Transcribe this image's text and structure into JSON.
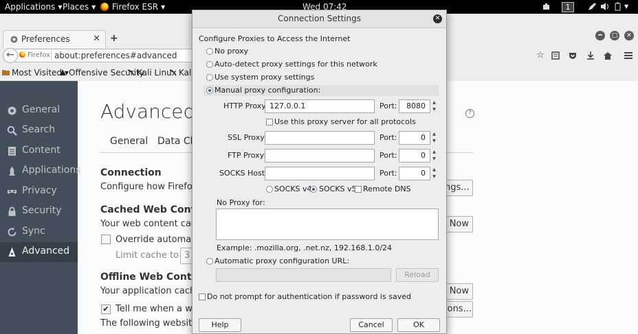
{
  "topbar": {
    "applications": "Applications",
    "places": "Places",
    "app_name": "Firefox ESR",
    "clock": "Wed 07:42",
    "workspace": "1"
  },
  "browser": {
    "tab_title": "Preferences",
    "identity_label": "Firefox",
    "url": "about:preferences#advanced",
    "bookmarks": [
      "Most Visited ▾",
      "Offensive Security",
      "Kali Linux",
      "Kali"
    ]
  },
  "prefs": {
    "sidebar": [
      {
        "label": "General",
        "icon": "gear-icon"
      },
      {
        "label": "Search",
        "icon": "search-icon"
      },
      {
        "label": "Content",
        "icon": "document-icon"
      },
      {
        "label": "Applications",
        "icon": "rocket-icon"
      },
      {
        "label": "Privacy",
        "icon": "mask-icon"
      },
      {
        "label": "Security",
        "icon": "lock-icon"
      },
      {
        "label": "Sync",
        "icon": "sync-icon"
      },
      {
        "label": "Advanced",
        "icon": "wizard-icon"
      }
    ],
    "heading": "Advanced",
    "subtabs": [
      "General",
      "Data Cho"
    ],
    "connection_title": "Connection",
    "connection_desc": "Configure how Firefox co",
    "settings_btn": "ngs...",
    "cached_title": "Cached Web Content",
    "cached_desc": "Your web content cache",
    "clear_now_1": "Now",
    "override_label": "Override automatic c",
    "limit_label": "Limit cache to",
    "limit_value": "3",
    "offline_title": "Offline Web Content a",
    "offline_desc": "Your application cache",
    "clear_now_2": "Now",
    "tell_me_label": "Tell me when a webs",
    "exceptions_btn": "ions...",
    "following_text": "The following websites a"
  },
  "dialog": {
    "title": "Connection Settings",
    "section_title": "Configure Proxies to Access the Internet",
    "no_proxy": "No proxy",
    "auto_detect": "Auto-detect proxy settings for this network",
    "system_proxy": "Use system proxy settings",
    "manual_proxy": "Manual proxy configuration:",
    "http_proxy_label": "HTTP Proxy:",
    "http_proxy_value": "127.0.0.1",
    "port_label": "Port:",
    "http_port": "8080",
    "share_proxy": "Use this proxy server for all protocols",
    "ssl_proxy_label": "SSL Proxy:",
    "ssl_port": "0",
    "ftp_proxy_label": "FTP Proxy:",
    "ftp_port": "0",
    "socks_host_label": "SOCKS Host:",
    "socks_port": "0",
    "socks_v4": "SOCKS v4",
    "socks_v5": "SOCKS v5",
    "remote_dns": "Remote DNS",
    "no_proxy_for": "No Proxy for:",
    "no_proxy_example": "Example: .mozilla.org, .net.nz, 192.168.1.0/24",
    "auto_config_url": "Automatic proxy configuration URL:",
    "reload": "Reload",
    "no_auth_prompt": "Do not prompt for authentication if password is saved",
    "help": "Help",
    "cancel": "Cancel",
    "ok": "OK"
  },
  "colors": {
    "sidebar_bg": "#424f5a",
    "sidebar_active": "#343f48",
    "radio_selected": "#2a5da8"
  }
}
